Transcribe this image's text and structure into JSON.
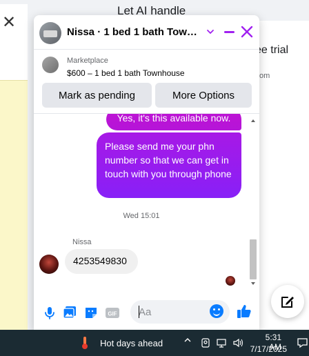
{
  "background": {
    "top_text": "Let AI handle",
    "right_text_1": "ee trial",
    "right_text_2": "om"
  },
  "chat": {
    "header_title": "Nissa · 1 bed 1 bath Townh…",
    "listing": {
      "label": "Marketplace",
      "subtitle": "$600 – 1 bed 1 bath Townhouse"
    },
    "actions": {
      "pending": "Mark as pending",
      "more": "More Options"
    },
    "messages": {
      "out_1": "Yes, it's this available now.",
      "out_2": "Please send me your phn number so that we can get in touch with you through phone",
      "timestamp": "Wed 15:01",
      "sender": "Nissa",
      "in_1": "4253549830"
    },
    "composer": {
      "placeholder": "Aa"
    },
    "accent_color": "#a020f0",
    "bubble_gradient": [
      "#b415d8",
      "#8a1ff6"
    ]
  },
  "taskbar": {
    "weather": "Hot days ahead",
    "time": "5:31 AM",
    "date": "7/17/2025"
  }
}
